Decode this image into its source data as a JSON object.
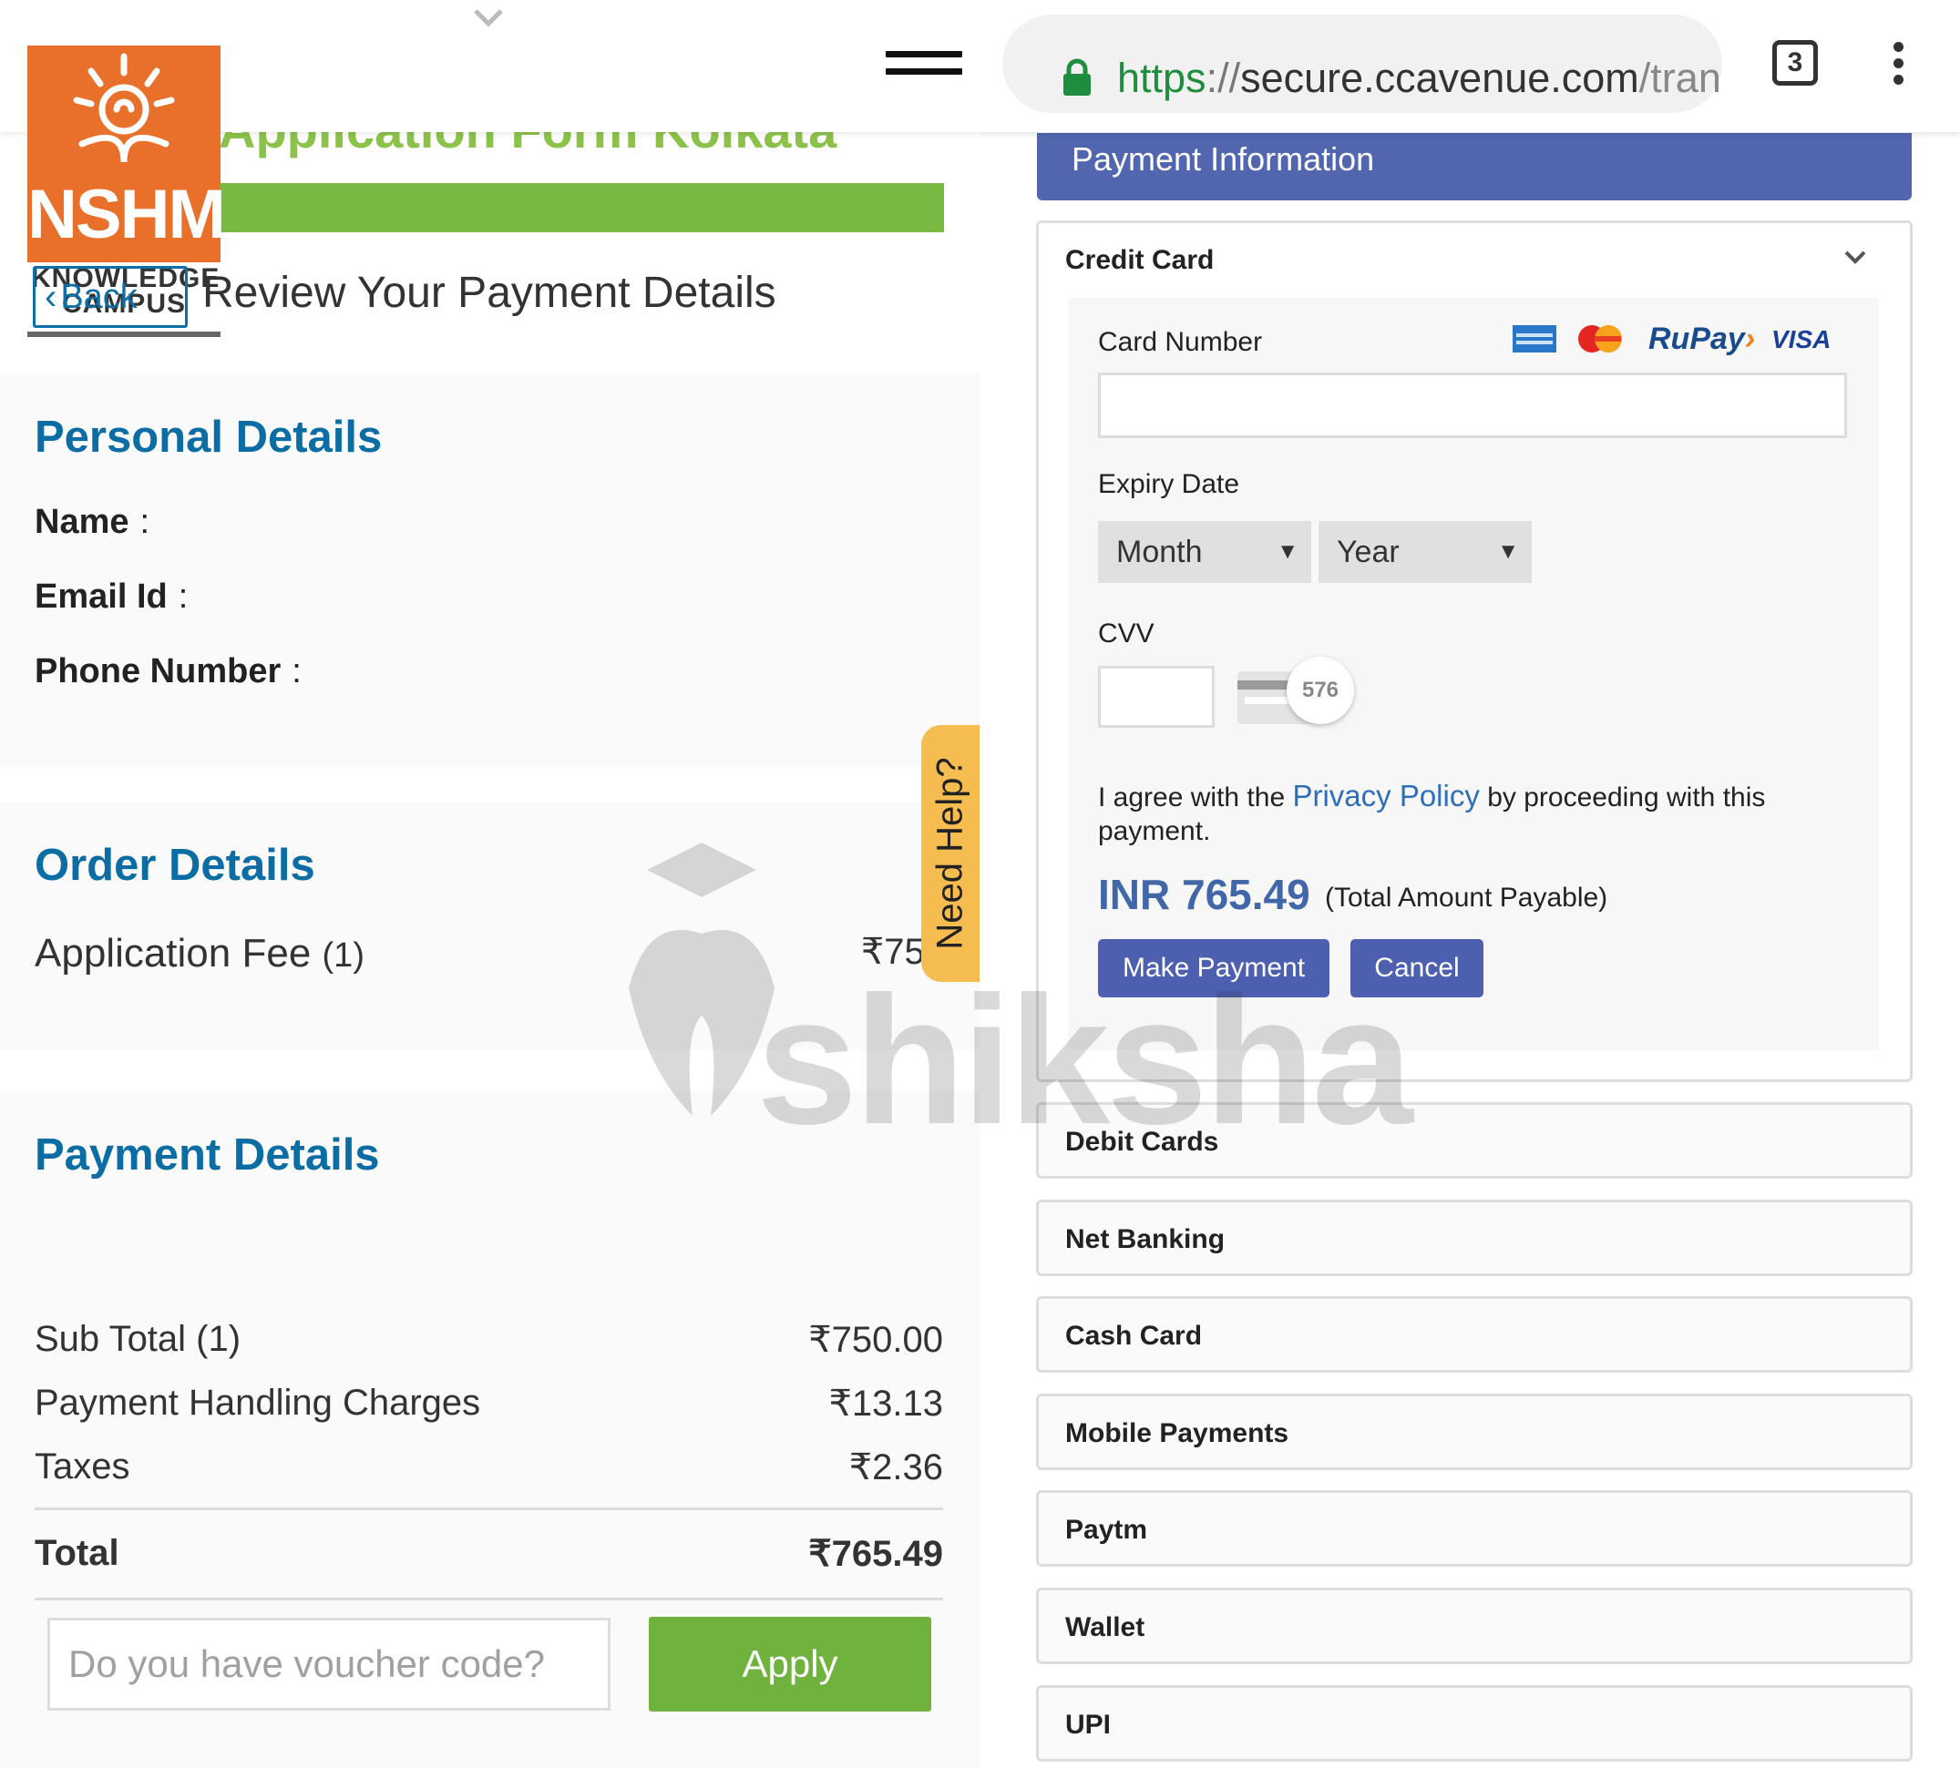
{
  "left": {
    "app_title": "Application Form Kolkata",
    "logo": {
      "main": "NSHM",
      "line1": "KNOWLEDGE",
      "line2": "CAMPUS"
    },
    "back_label": "Back",
    "review_title": "Review Your Payment Details",
    "personal": {
      "title": "Personal Details",
      "name_label": "Name",
      "email_label": "Email Id",
      "phone_label": "Phone Number",
      "colon": ":"
    },
    "order": {
      "title": "Order Details",
      "item_label": "Application Fee",
      "item_qty": "(1)",
      "item_price": "₹750"
    },
    "payment": {
      "title": "Payment Details",
      "rows": [
        {
          "label": "Sub Total (1)",
          "value": "₹750.00"
        },
        {
          "label": "Payment Handling Charges",
          "value": "₹13.13"
        },
        {
          "label": "Taxes",
          "value": "₹2.36"
        }
      ],
      "total_label": "Total",
      "total_value": "₹765.49"
    },
    "voucher_placeholder": "Do you have voucher code?",
    "apply_label": "Apply",
    "help_label": "Need Help?"
  },
  "right": {
    "url": {
      "scheme": "https",
      "separator": "://",
      "host": "secure.ccavenue.com",
      "path": "/tran"
    },
    "tab_count": "3",
    "header": "Payment Information",
    "credit_card": {
      "title": "Credit Card",
      "card_number_label": "Card Number",
      "card_brands": [
        "AMERICAN EXPRESS",
        "MasterCard",
        "RuPay",
        "VISA"
      ],
      "expiry_label": "Expiry Date",
      "month_value": "Month",
      "year_value": "Year",
      "cvv_label": "CVV",
      "cvv_hint": "576",
      "agree_prefix": "I agree with the",
      "privacy_link": "Privacy Policy",
      "agree_suffix": "by proceeding with this payment.",
      "amount": "INR 765.49",
      "amount_note": "(Total Amount Payable)",
      "make_payment": "Make Payment",
      "cancel": "Cancel"
    },
    "methods": [
      "Debit Cards",
      "Net Banking",
      "Cash Card",
      "Mobile Payments",
      "Paytm",
      "Wallet",
      "UPI"
    ]
  },
  "watermark": "shiksha",
  "colors": {
    "brand_blue": "#0b6da4",
    "green": "#6fb33e",
    "logo_orange": "#e8702a",
    "header_blue": "#5266b0",
    "button_blue": "#4d60b0",
    "help_yellow": "#f5bd4f"
  }
}
